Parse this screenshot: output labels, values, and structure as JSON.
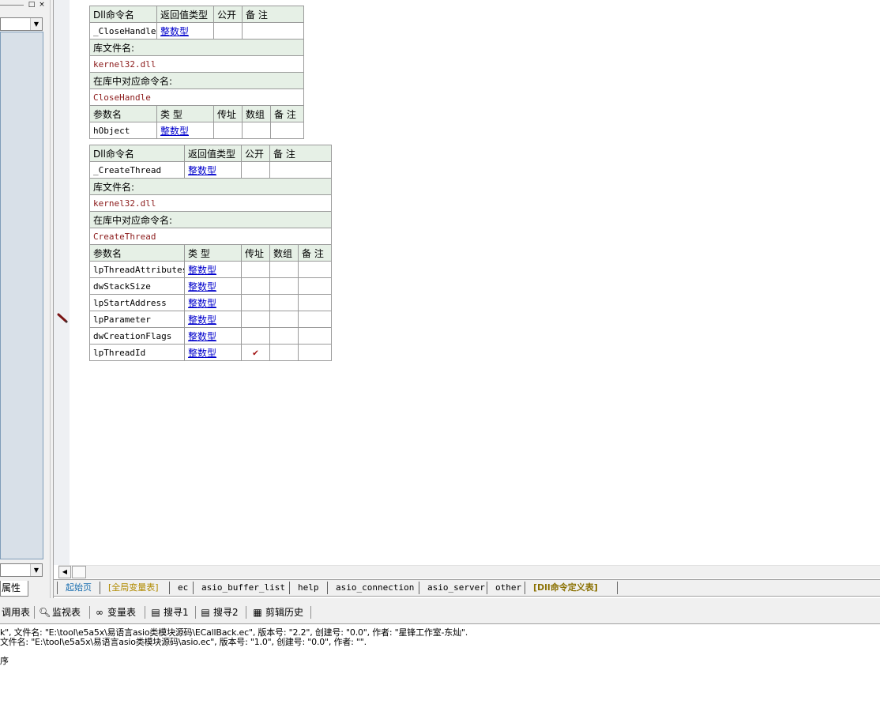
{
  "left_panel": {
    "tab_label": "属性",
    "titlebar_buttons": [
      "□",
      "×"
    ]
  },
  "dll_tables": [
    {
      "header": {
        "name": "Dll命令名",
        "return_type": "返回值类型",
        "public": "公开",
        "remark": "备 注"
      },
      "command": {
        "name": "_CloseHandle",
        "return_type": "整数型"
      },
      "lib_label": "库文件名:",
      "lib_value": "kernel32.dll",
      "alias_label": "在库中对应命令名:",
      "alias_value": "CloseHandle",
      "param_header": {
        "name": "参数名",
        "type": "类 型",
        "byref": "传址",
        "array": "数组",
        "remark": "备 注"
      },
      "params": [
        {
          "name": "hObject",
          "type": "整数型",
          "byref": ""
        }
      ]
    },
    {
      "header": {
        "name": "Dll命令名",
        "return_type": "返回值类型",
        "public": "公开",
        "remark": "备 注"
      },
      "command": {
        "name": "_CreateThread",
        "return_type": "整数型"
      },
      "lib_label": "库文件名:",
      "lib_value": "kernel32.dll",
      "alias_label": "在库中对应命令名:",
      "alias_value": "CreateThread",
      "param_header": {
        "name": "参数名",
        "type": "类 型",
        "byref": "传址",
        "array": "数组",
        "remark": "备 注"
      },
      "params": [
        {
          "name": "lpThreadAttributes",
          "type": "整数型",
          "byref": ""
        },
        {
          "name": "dwStackSize",
          "type": "整数型",
          "byref": ""
        },
        {
          "name": "lpStartAddress",
          "type": "整数型",
          "byref": ""
        },
        {
          "name": "lpParameter",
          "type": "整数型",
          "byref": ""
        },
        {
          "name": "dwCreationFlags",
          "type": "整数型",
          "byref": ""
        },
        {
          "name": "lpThreadId",
          "type": "整数型",
          "byref": "✔"
        }
      ]
    }
  ],
  "file_tabs": [
    {
      "label": "起始页",
      "color": "#1a6fb0"
    },
    {
      "label": "[全局变量表]",
      "color": "#b08a00"
    },
    {
      "label": "ec",
      "color": "#000000"
    },
    {
      "label": "asio_buffer_list",
      "color": "#000000"
    },
    {
      "label": "help",
      "color": "#000000"
    },
    {
      "label": "asio_connection",
      "color": "#000000"
    },
    {
      "label": "asio_server",
      "color": "#000000"
    },
    {
      "label": "other",
      "color": "#000000"
    },
    {
      "label": "[Dll命令定义表]",
      "color": "#8a7000"
    }
  ],
  "bottom_toolbar": [
    {
      "label": "调用表",
      "icon": ""
    },
    {
      "label": "监视表",
      "icon": "magnifier-icon"
    },
    {
      "label": "变量表",
      "icon": "glasses-icon"
    },
    {
      "label": "搜寻1",
      "icon": "search-doc-icon"
    },
    {
      "label": "搜寻2",
      "icon": "search-doc-icon"
    },
    {
      "label": "剪辑历史",
      "icon": "clipboard-icon"
    }
  ],
  "output_lines": [
    "k\", 文件名: \"E:\\tool\\e5a5x\\易语言asio类模块源码\\ECallBack.ec\", 版本号: \"2.2\", 创建号: \"0.0\", 作者: \"星锋工作室-东灿\".",
    "文件名: \"E:\\tool\\e5a5x\\易语言asio类模块源码\\asio.ec\", 版本号: \"1.0\", 创建号: \"0.0\", 作者: \"\".",
    "",
    "序"
  ]
}
